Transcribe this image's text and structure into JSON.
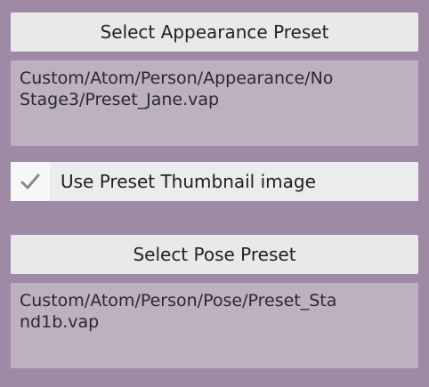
{
  "appearance": {
    "button_label": "Select Appearance Preset",
    "path_text": "Custom/Atom/Person/Appearance/No\nStage3/Preset_Jane.vap",
    "toggle_label": "Use Preset Thumbnail image",
    "toggle_checked": true
  },
  "pose": {
    "button_label": "Select Pose Preset",
    "path_text": "Custom/Atom/Person/Pose/Preset_Sta\nnd1b.vap"
  },
  "icons": {
    "check": "checkmark-icon"
  },
  "colors": {
    "background": "#9f8aa5",
    "button": "#e9e9e9",
    "path_box": "#bcb0c1",
    "checkmark": "#8a8a8a"
  }
}
